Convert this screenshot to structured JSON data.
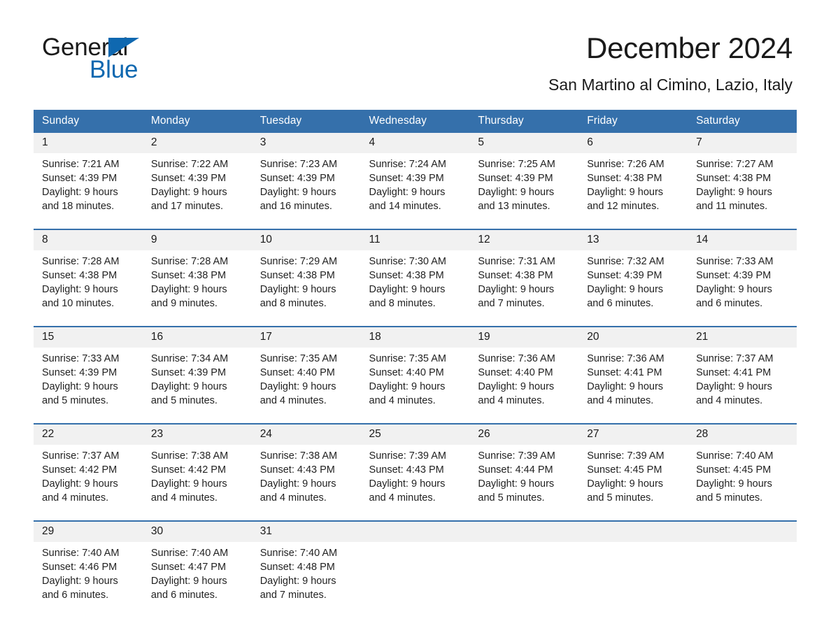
{
  "brand": {
    "name_part1": "General",
    "name_part2": "Blue",
    "accent_color": "#0f68b0"
  },
  "header": {
    "title": "December 2024",
    "subtitle": "San Martino al Cimino, Lazio, Italy",
    "header_color": "#3570ab"
  },
  "weekdays": [
    "Sunday",
    "Monday",
    "Tuesday",
    "Wednesday",
    "Thursday",
    "Friday",
    "Saturday"
  ],
  "weeks": [
    [
      {
        "day": "1",
        "sunrise": "Sunrise: 7:21 AM",
        "sunset": "Sunset: 4:39 PM",
        "daylight_line1": "Daylight: 9 hours",
        "daylight_line2": "and 18 minutes."
      },
      {
        "day": "2",
        "sunrise": "Sunrise: 7:22 AM",
        "sunset": "Sunset: 4:39 PM",
        "daylight_line1": "Daylight: 9 hours",
        "daylight_line2": "and 17 minutes."
      },
      {
        "day": "3",
        "sunrise": "Sunrise: 7:23 AM",
        "sunset": "Sunset: 4:39 PM",
        "daylight_line1": "Daylight: 9 hours",
        "daylight_line2": "and 16 minutes."
      },
      {
        "day": "4",
        "sunrise": "Sunrise: 7:24 AM",
        "sunset": "Sunset: 4:39 PM",
        "daylight_line1": "Daylight: 9 hours",
        "daylight_line2": "and 14 minutes."
      },
      {
        "day": "5",
        "sunrise": "Sunrise: 7:25 AM",
        "sunset": "Sunset: 4:39 PM",
        "daylight_line1": "Daylight: 9 hours",
        "daylight_line2": "and 13 minutes."
      },
      {
        "day": "6",
        "sunrise": "Sunrise: 7:26 AM",
        "sunset": "Sunset: 4:38 PM",
        "daylight_line1": "Daylight: 9 hours",
        "daylight_line2": "and 12 minutes."
      },
      {
        "day": "7",
        "sunrise": "Sunrise: 7:27 AM",
        "sunset": "Sunset: 4:38 PM",
        "daylight_line1": "Daylight: 9 hours",
        "daylight_line2": "and 11 minutes."
      }
    ],
    [
      {
        "day": "8",
        "sunrise": "Sunrise: 7:28 AM",
        "sunset": "Sunset: 4:38 PM",
        "daylight_line1": "Daylight: 9 hours",
        "daylight_line2": "and 10 minutes."
      },
      {
        "day": "9",
        "sunrise": "Sunrise: 7:28 AM",
        "sunset": "Sunset: 4:38 PM",
        "daylight_line1": "Daylight: 9 hours",
        "daylight_line2": "and 9 minutes."
      },
      {
        "day": "10",
        "sunrise": "Sunrise: 7:29 AM",
        "sunset": "Sunset: 4:38 PM",
        "daylight_line1": "Daylight: 9 hours",
        "daylight_line2": "and 8 minutes."
      },
      {
        "day": "11",
        "sunrise": "Sunrise: 7:30 AM",
        "sunset": "Sunset: 4:38 PM",
        "daylight_line1": "Daylight: 9 hours",
        "daylight_line2": "and 8 minutes."
      },
      {
        "day": "12",
        "sunrise": "Sunrise: 7:31 AM",
        "sunset": "Sunset: 4:38 PM",
        "daylight_line1": "Daylight: 9 hours",
        "daylight_line2": "and 7 minutes."
      },
      {
        "day": "13",
        "sunrise": "Sunrise: 7:32 AM",
        "sunset": "Sunset: 4:39 PM",
        "daylight_line1": "Daylight: 9 hours",
        "daylight_line2": "and 6 minutes."
      },
      {
        "day": "14",
        "sunrise": "Sunrise: 7:33 AM",
        "sunset": "Sunset: 4:39 PM",
        "daylight_line1": "Daylight: 9 hours",
        "daylight_line2": "and 6 minutes."
      }
    ],
    [
      {
        "day": "15",
        "sunrise": "Sunrise: 7:33 AM",
        "sunset": "Sunset: 4:39 PM",
        "daylight_line1": "Daylight: 9 hours",
        "daylight_line2": "and 5 minutes."
      },
      {
        "day": "16",
        "sunrise": "Sunrise: 7:34 AM",
        "sunset": "Sunset: 4:39 PM",
        "daylight_line1": "Daylight: 9 hours",
        "daylight_line2": "and 5 minutes."
      },
      {
        "day": "17",
        "sunrise": "Sunrise: 7:35 AM",
        "sunset": "Sunset: 4:40 PM",
        "daylight_line1": "Daylight: 9 hours",
        "daylight_line2": "and 4 minutes."
      },
      {
        "day": "18",
        "sunrise": "Sunrise: 7:35 AM",
        "sunset": "Sunset: 4:40 PM",
        "daylight_line1": "Daylight: 9 hours",
        "daylight_line2": "and 4 minutes."
      },
      {
        "day": "19",
        "sunrise": "Sunrise: 7:36 AM",
        "sunset": "Sunset: 4:40 PM",
        "daylight_line1": "Daylight: 9 hours",
        "daylight_line2": "and 4 minutes."
      },
      {
        "day": "20",
        "sunrise": "Sunrise: 7:36 AM",
        "sunset": "Sunset: 4:41 PM",
        "daylight_line1": "Daylight: 9 hours",
        "daylight_line2": "and 4 minutes."
      },
      {
        "day": "21",
        "sunrise": "Sunrise: 7:37 AM",
        "sunset": "Sunset: 4:41 PM",
        "daylight_line1": "Daylight: 9 hours",
        "daylight_line2": "and 4 minutes."
      }
    ],
    [
      {
        "day": "22",
        "sunrise": "Sunrise: 7:37 AM",
        "sunset": "Sunset: 4:42 PM",
        "daylight_line1": "Daylight: 9 hours",
        "daylight_line2": "and 4 minutes."
      },
      {
        "day": "23",
        "sunrise": "Sunrise: 7:38 AM",
        "sunset": "Sunset: 4:42 PM",
        "daylight_line1": "Daylight: 9 hours",
        "daylight_line2": "and 4 minutes."
      },
      {
        "day": "24",
        "sunrise": "Sunrise: 7:38 AM",
        "sunset": "Sunset: 4:43 PM",
        "daylight_line1": "Daylight: 9 hours",
        "daylight_line2": "and 4 minutes."
      },
      {
        "day": "25",
        "sunrise": "Sunrise: 7:39 AM",
        "sunset": "Sunset: 4:43 PM",
        "daylight_line1": "Daylight: 9 hours",
        "daylight_line2": "and 4 minutes."
      },
      {
        "day": "26",
        "sunrise": "Sunrise: 7:39 AM",
        "sunset": "Sunset: 4:44 PM",
        "daylight_line1": "Daylight: 9 hours",
        "daylight_line2": "and 5 minutes."
      },
      {
        "day": "27",
        "sunrise": "Sunrise: 7:39 AM",
        "sunset": "Sunset: 4:45 PM",
        "daylight_line1": "Daylight: 9 hours",
        "daylight_line2": "and 5 minutes."
      },
      {
        "day": "28",
        "sunrise": "Sunrise: 7:40 AM",
        "sunset": "Sunset: 4:45 PM",
        "daylight_line1": "Daylight: 9 hours",
        "daylight_line2": "and 5 minutes."
      }
    ],
    [
      {
        "day": "29",
        "sunrise": "Sunrise: 7:40 AM",
        "sunset": "Sunset: 4:46 PM",
        "daylight_line1": "Daylight: 9 hours",
        "daylight_line2": "and 6 minutes."
      },
      {
        "day": "30",
        "sunrise": "Sunrise: 7:40 AM",
        "sunset": "Sunset: 4:47 PM",
        "daylight_line1": "Daylight: 9 hours",
        "daylight_line2": "and 6 minutes."
      },
      {
        "day": "31",
        "sunrise": "Sunrise: 7:40 AM",
        "sunset": "Sunset: 4:48 PM",
        "daylight_line1": "Daylight: 9 hours",
        "daylight_line2": "and 7 minutes."
      },
      {
        "day": "",
        "sunrise": "",
        "sunset": "",
        "daylight_line1": "",
        "daylight_line2": ""
      },
      {
        "day": "",
        "sunrise": "",
        "sunset": "",
        "daylight_line1": "",
        "daylight_line2": ""
      },
      {
        "day": "",
        "sunrise": "",
        "sunset": "",
        "daylight_line1": "",
        "daylight_line2": ""
      },
      {
        "day": "",
        "sunrise": "",
        "sunset": "",
        "daylight_line1": "",
        "daylight_line2": ""
      }
    ]
  ]
}
